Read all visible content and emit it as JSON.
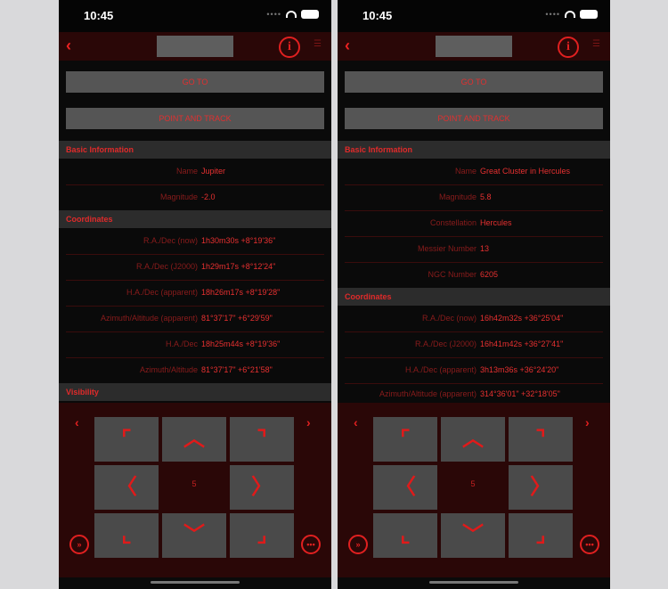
{
  "screens": [
    {
      "status_time": "10:45",
      "nav_title": "",
      "goto_label": "GO TO",
      "point_track_label": "POINT AND TRACK",
      "sections": [
        {
          "title": "Basic Information",
          "rows": [
            {
              "label": "Name",
              "value": "Jupiter"
            },
            {
              "label": "Magnitude",
              "value": "-2.0"
            }
          ]
        },
        {
          "title": "Coordinates",
          "rows": [
            {
              "label": "R.A./Dec (now)",
              "value": "1h30m30s +8°19'36\""
            },
            {
              "label": "R.A./Dec (J2000)",
              "value": "1h29m17s +8°12'24\""
            },
            {
              "label": "H.A./Dec (apparent)",
              "value": "18h26m17s +8°19'28\""
            },
            {
              "label": "Azimuth/Altitude (apparent)",
              "value": "81°37'17\" +6°29'59\""
            },
            {
              "label": "H.A./Dec",
              "value": "18h25m44s +8°19'36\""
            },
            {
              "label": "Azimuth/Altitude",
              "value": "81°37'17\" +6°21'58\""
            }
          ]
        },
        {
          "title": "Visibility",
          "rows": []
        }
      ],
      "pad_center": "5"
    },
    {
      "status_time": "10:45",
      "nav_title": "",
      "goto_label": "GO TO",
      "point_track_label": "POINT AND TRACK",
      "sections": [
        {
          "title": "Basic Information",
          "rows": [
            {
              "label": "Name",
              "value": "Great Cluster in Hercules"
            },
            {
              "label": "Magnitude",
              "value": "5.8"
            },
            {
              "label": "Constellation",
              "value": "Hercules"
            },
            {
              "label": "Messier Number",
              "value": "13"
            },
            {
              "label": "NGC Number",
              "value": "6205"
            }
          ]
        },
        {
          "title": "Coordinates",
          "rows": [
            {
              "label": "R.A./Dec (now)",
              "value": "16h42m32s +36°25'04\""
            },
            {
              "label": "R.A./Dec (J2000)",
              "value": "16h41m42s +36°27'41\""
            },
            {
              "label": "H.A./Dec (apparent)",
              "value": "3h13m36s +36°24'20\""
            },
            {
              "label": "Azimuth/Altitude (apparent)",
              "value": "314°36'01\" +32°18'05\""
            }
          ]
        }
      ],
      "pad_center": "5"
    }
  ],
  "glyphs": {
    "back": "‹",
    "info": "i",
    "left": "‹",
    "right": "›",
    "pad": [
      "⌜",
      "︿",
      "⌝",
      "〈",
      "〉",
      "⌞",
      "﹀",
      "⌟"
    ],
    "collapse": "»",
    "menu": "•••"
  },
  "colors": {
    "accent": "#e02020",
    "panel": "#2a0707",
    "button": "#555555"
  }
}
